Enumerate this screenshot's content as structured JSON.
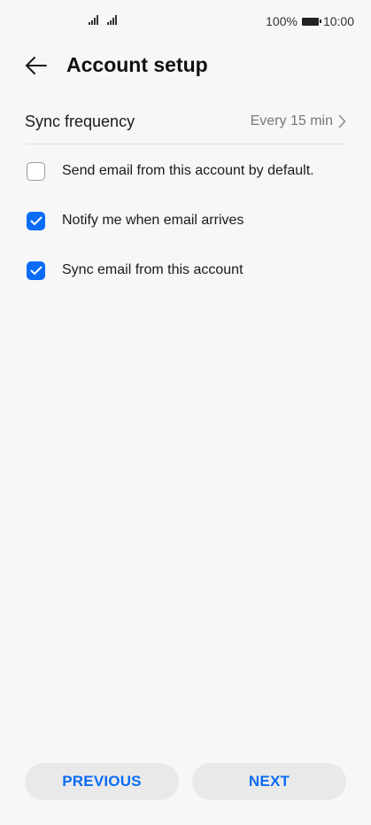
{
  "status_bar": {
    "battery_percent": "100%",
    "time": "10:00"
  },
  "header": {
    "title": "Account setup",
    "back_icon": "arrow-left-icon"
  },
  "sync_frequency": {
    "label": "Sync frequency",
    "value": "Every 15 min",
    "icon": "chevron-right-icon"
  },
  "options": [
    {
      "label": "Send email from this account by default.",
      "checked": false
    },
    {
      "label": "Notify me when email arrives",
      "checked": true
    },
    {
      "label": "Sync email from this account",
      "checked": true
    }
  ],
  "buttons": {
    "previous": "PREVIOUS",
    "next": "NEXT"
  },
  "colors": {
    "accent": "#0a6cf5",
    "background": "#f7f7f7",
    "button_bg": "#e9e9e9"
  }
}
